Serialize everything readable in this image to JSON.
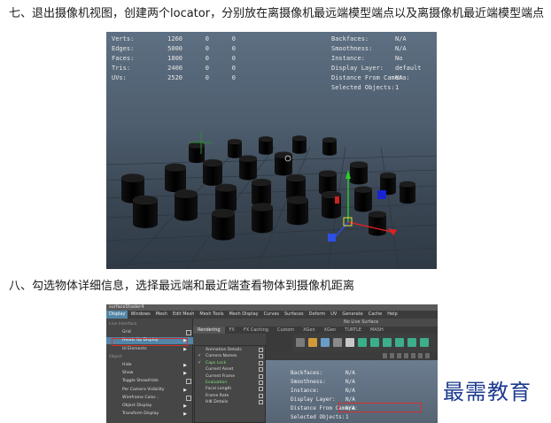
{
  "step7": "七、退出摄像机视图，创建两个locator，分别放在离摄像机最远端模型端点以及离摄像机最近端模型端点",
  "step8": "八、勾选物体详细信息，选择最远端和最近端查看物体到摄像机距离",
  "viewport1": {
    "poly_count": [
      {
        "label": "Verts:",
        "v": [
          "1260",
          "0",
          "0"
        ]
      },
      {
        "label": "Edges:",
        "v": [
          "5000",
          "0",
          "0"
        ]
      },
      {
        "label": "Faces:",
        "v": [
          "1800",
          "0",
          "0"
        ]
      },
      {
        "label": "Tris:",
        "v": [
          "2400",
          "0",
          "0"
        ]
      },
      {
        "label": "UVs:",
        "v": [
          "2520",
          "0",
          "0"
        ]
      }
    ],
    "object_details": [
      {
        "label": "Backfaces:",
        "value": "N/A"
      },
      {
        "label": "Smoothness:",
        "value": "N/A"
      },
      {
        "label": "Instance:",
        "value": "No"
      },
      {
        "label": "Display Layer:",
        "value": "default"
      },
      {
        "label": "Distance From Camera:",
        "value": "NA"
      },
      {
        "label": "Selected Objects:",
        "value": "1"
      }
    ]
  },
  "maya": {
    "title": "surfaceShader4",
    "menubar": [
      "Display",
      "Windows",
      "Mesh",
      "Edit Mesh",
      "Mesh Tools",
      "Mesh Display",
      "Curves",
      "Surfaces",
      "Deform",
      "UV",
      "Generate",
      "Cache",
      "Help"
    ],
    "status_text": "No Live Surface",
    "shelf_tabs": [
      "Rendering",
      "FX",
      "FX Caching",
      "Custom",
      "XGen",
      "XGen",
      "TURTLE",
      "MASH"
    ],
    "display_menu": [
      {
        "label": "Live Interface",
        "type": "section"
      },
      {
        "label": "Grid",
        "box": true
      },
      {
        "label": "Heads Up Display",
        "arrow": true,
        "hl": true
      },
      {
        "label": "UI Elements",
        "arrow": true
      },
      {
        "label": "Object",
        "type": "section"
      },
      {
        "label": "Hide",
        "arrow": true
      },
      {
        "label": "Show",
        "arrow": true
      },
      {
        "label": "Toggle Show/Hide",
        "box": true
      },
      {
        "label": "Per Camera Visibility",
        "arrow": true
      },
      {
        "label": "Wireframe Color...",
        "box": true
      },
      {
        "label": "Object Display",
        "arrow": true
      },
      {
        "label": "Transform Display",
        "arrow": true
      }
    ],
    "hud_menu": [
      {
        "label": "Animation Details",
        "checked": false
      },
      {
        "label": "Camera Names",
        "checked": true
      },
      {
        "label": "Caps Lock",
        "checked": true
      },
      {
        "label": "Current Asset",
        "checked": false
      },
      {
        "label": "Current Frame",
        "checked": false
      },
      {
        "label": "Evaluation",
        "checked": false
      },
      {
        "label": "Focal Length",
        "checked": false
      },
      {
        "label": "Frame Rate",
        "checked": false
      },
      {
        "label": "HIK Details",
        "checked": false
      }
    ],
    "object_details": [
      {
        "label": "Backfaces:",
        "value": "N/A"
      },
      {
        "label": "Smoothness:",
        "value": "N/A"
      },
      {
        "label": "Instance:",
        "value": "N/A"
      },
      {
        "label": "Display Layer:",
        "value": "N/A"
      },
      {
        "label": "Distance From Camera:",
        "value": "N/A"
      },
      {
        "label": "Selected Objects:",
        "value": "1"
      }
    ]
  },
  "watermark": "最需教育",
  "colors": {
    "menu_highlight": "#5285a6",
    "annotation_red": "#d0312d",
    "watermark": "#1d3b8f"
  }
}
